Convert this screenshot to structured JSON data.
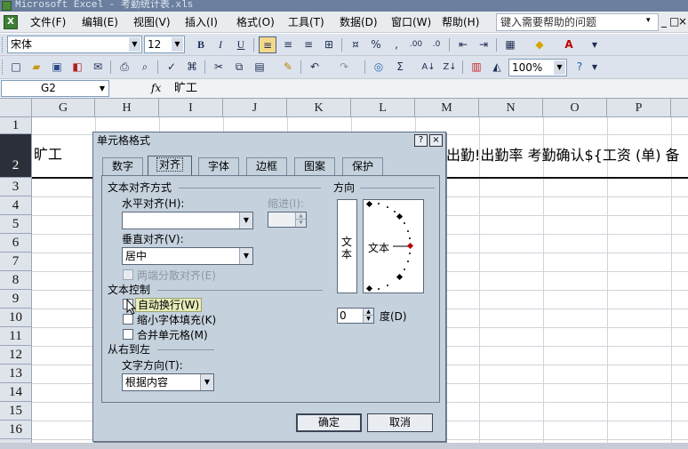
{
  "window": {
    "title": "Microsoft Excel - 考勤统计表.xls"
  },
  "menubar": {
    "items": [
      "文件(F)",
      "编辑(E)",
      "视图(V)",
      "插入(I)",
      "格式(O)",
      "工具(T)",
      "数据(D)",
      "窗口(W)",
      "帮助(H)"
    ],
    "help_placeholder": "键入需要帮助的问题",
    "controls": [
      "▾",
      "_",
      "□",
      "×"
    ]
  },
  "format_toolbar": {
    "font": "宋体",
    "size": "12",
    "bold": "B",
    "italic": "I",
    "underline": "U",
    "percent": "%",
    "comma": ","
  },
  "standard_toolbar": {
    "zoom": "100%",
    "sigma": "Σ"
  },
  "formula_bar": {
    "name_box": "G2",
    "fx": "fx",
    "value": "旷工"
  },
  "grid": {
    "columns": [
      "G",
      "H",
      "I",
      "J",
      "K",
      "L",
      "M",
      "N",
      "O",
      "P"
    ],
    "rows": [
      "1",
      "2",
      "3",
      "4",
      "5",
      "6",
      "7",
      "8",
      "9",
      "10",
      "11",
      "12",
      "13",
      "14",
      "15",
      "16"
    ],
    "cells": {
      "g2": "旷工",
      "right_text": "出勤!出勤率   考勤确认${工资 (单) 备"
    }
  },
  "dialog": {
    "title": "单元格格式",
    "help_btn": "?",
    "close_btn": "×",
    "tabs": [
      "数字",
      "对齐",
      "字体",
      "边框",
      "图案",
      "保护"
    ],
    "active_tab": "对齐",
    "text_alignment": {
      "group_label": "文本对齐方式",
      "horizontal_label": "水平对齐(H):",
      "horizontal_value": "",
      "indent_label": "缩进(I):",
      "indent_value": "",
      "vertical_label": "垂直对齐(V):",
      "vertical_value": "居中",
      "justify_distributed_label": "两端分散对齐(E)"
    },
    "text_control": {
      "group_label": "文本控制",
      "wrap_text_label": "自动换行(W)",
      "wrap_text_checked": false,
      "shrink_to_fit_label": "缩小字体填充(K)",
      "shrink_to_fit_checked": false,
      "merge_cells_label": "合并单元格(M)",
      "merge_cells_checked": false
    },
    "right_to_left": {
      "group_label": "从右到左",
      "direction_label": "文字方向(T):",
      "direction_value": "根据内容"
    },
    "orientation": {
      "group_label": "方向",
      "vertical_text": "文本",
      "horizontal_text": "文本",
      "degrees_value": "0",
      "degrees_label": "度(D)"
    },
    "ok_label": "确定",
    "cancel_label": "取消"
  }
}
